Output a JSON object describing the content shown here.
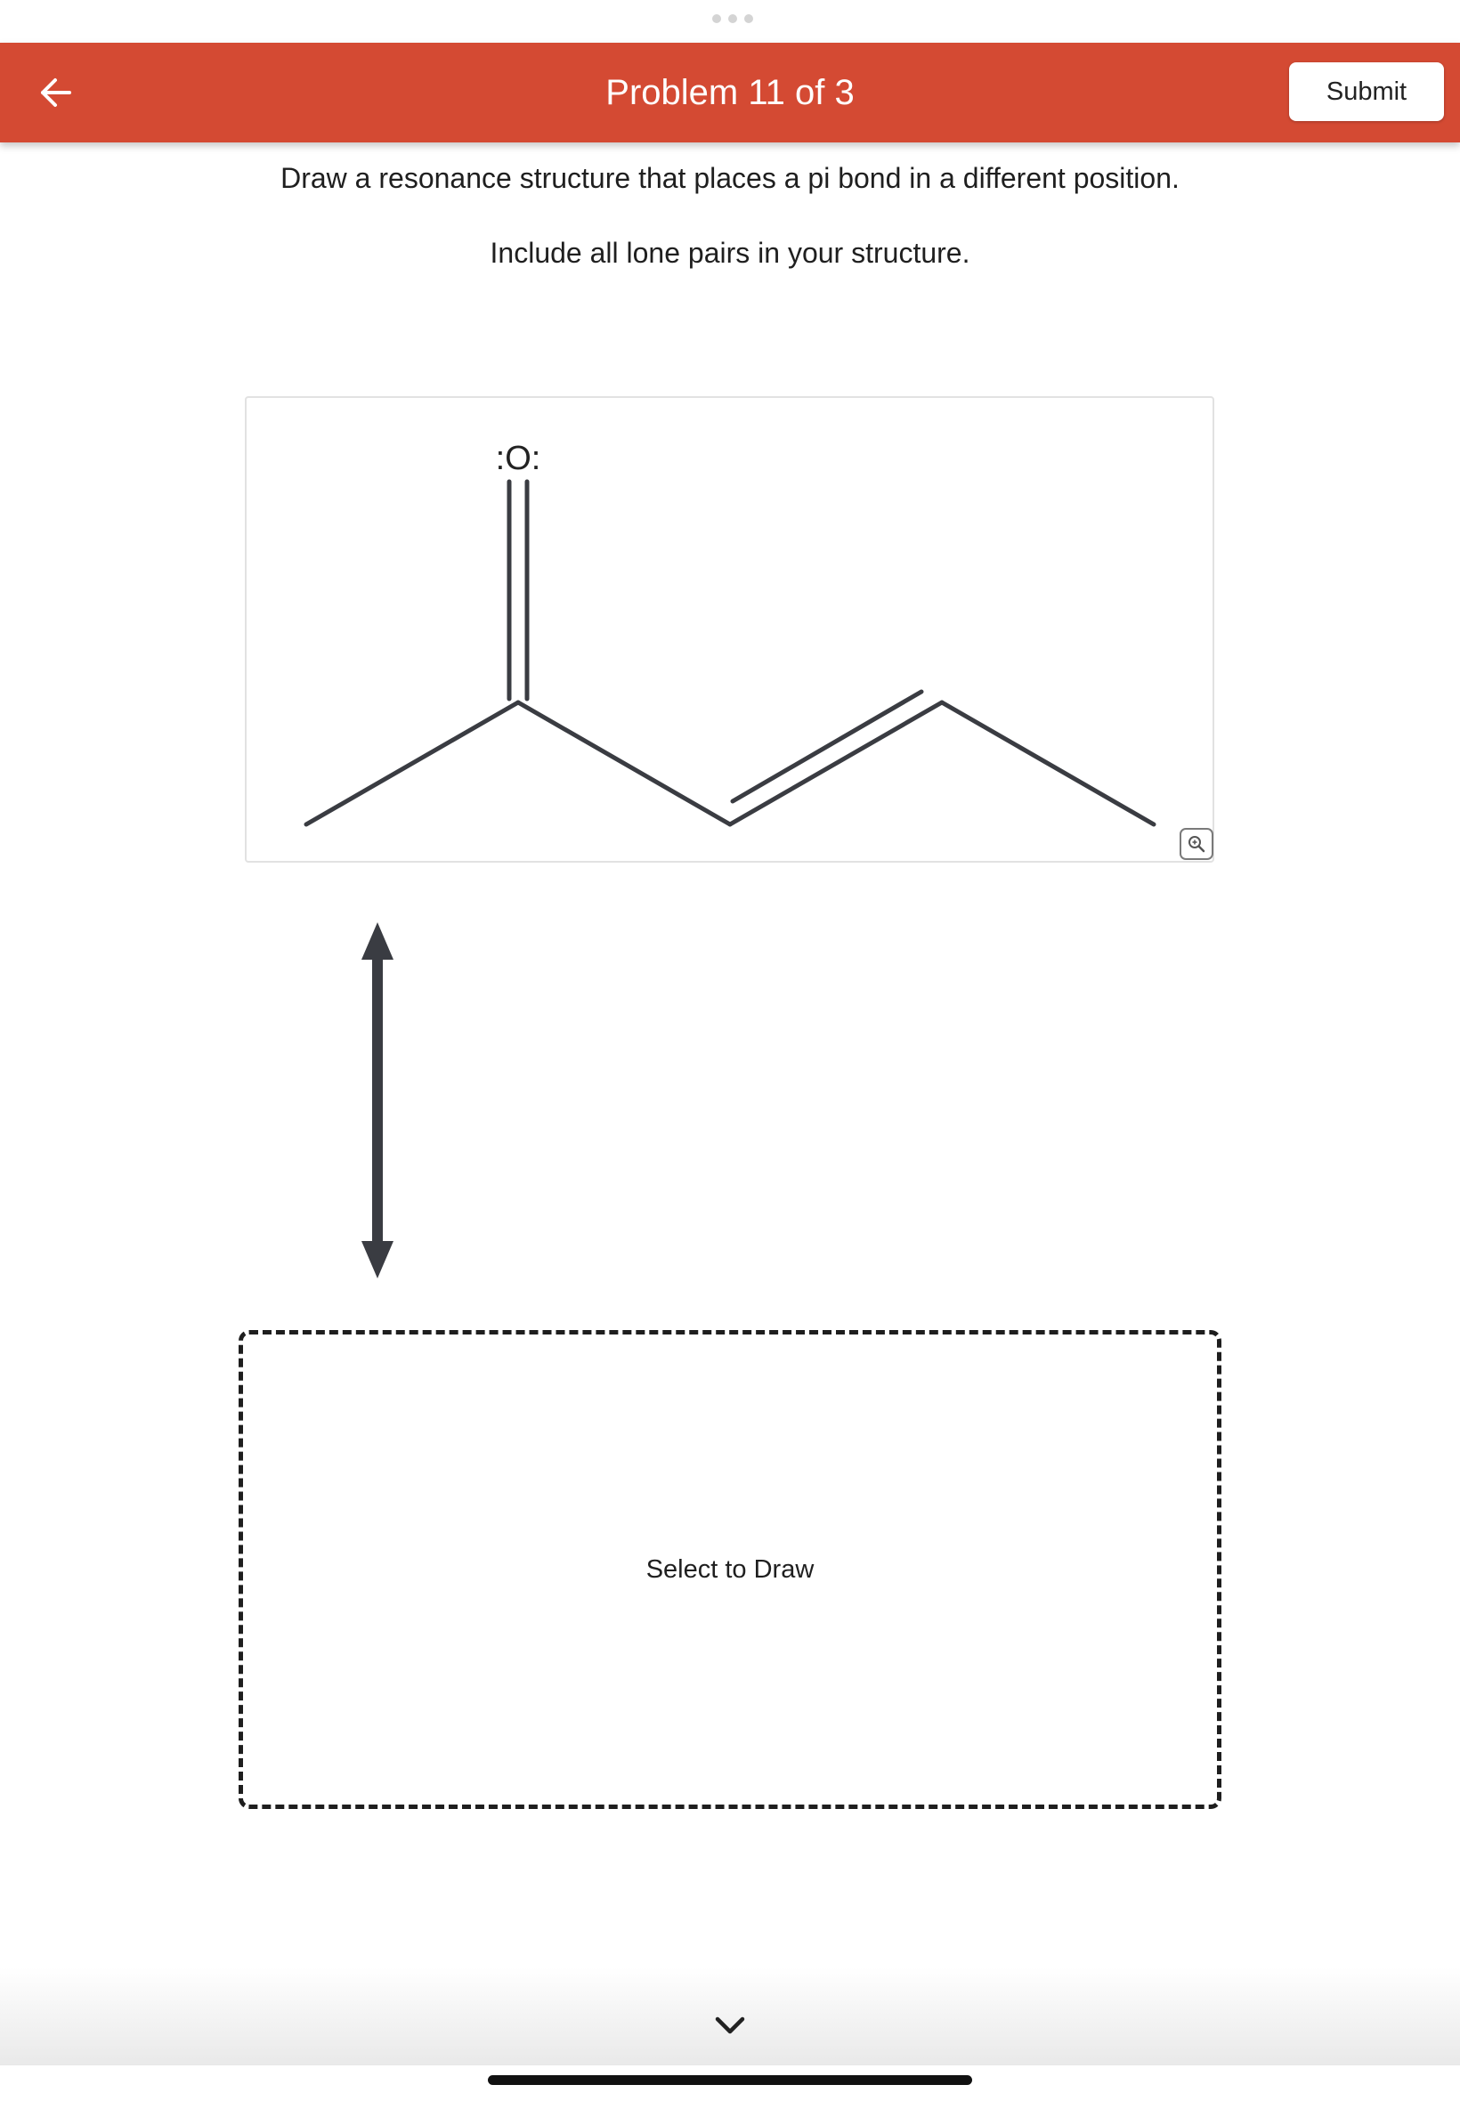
{
  "header": {
    "title": "Problem 11 of 3",
    "submit_label": "Submit",
    "background_color": "#d44a33"
  },
  "instructions": {
    "line1": "Draw a resonance structure that places a pi bond in a different position.",
    "line2": "Include all lone pairs in your structure."
  },
  "molecule": {
    "oxygen_label": ":O:"
  },
  "draw_area": {
    "label": "Select to Draw"
  },
  "icons": {
    "back": "arrow-left-icon",
    "zoom": "magnifier-icon",
    "resonance": "double-headed-arrow-icon",
    "expand": "chevron-down-icon"
  }
}
